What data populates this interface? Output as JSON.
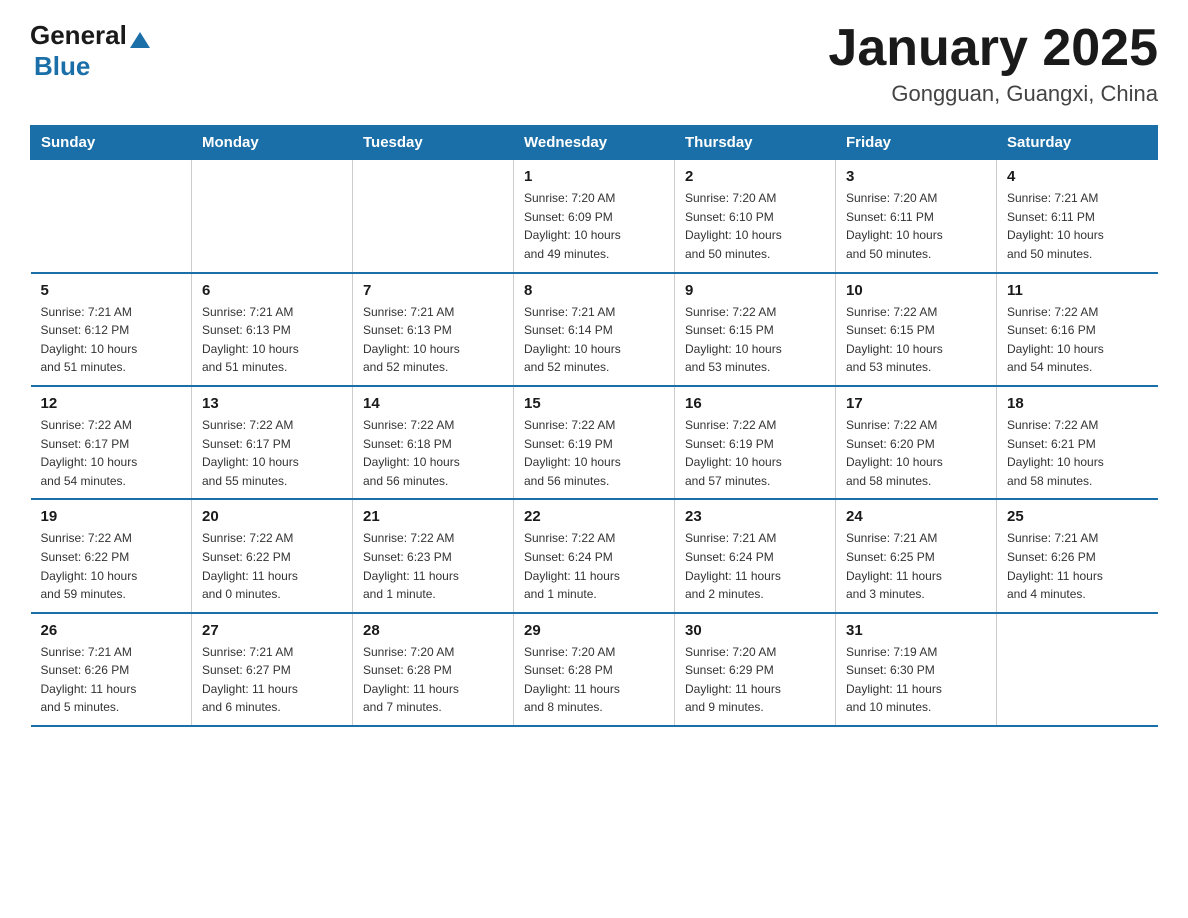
{
  "logo": {
    "general": "General",
    "triangle_color": "#1a6fa8",
    "blue": "Blue"
  },
  "title": "January 2025",
  "location": "Gongguan, Guangxi, China",
  "days_of_week": [
    "Sunday",
    "Monday",
    "Tuesday",
    "Wednesday",
    "Thursday",
    "Friday",
    "Saturday"
  ],
  "weeks": [
    [
      {
        "day": "",
        "info": ""
      },
      {
        "day": "",
        "info": ""
      },
      {
        "day": "",
        "info": ""
      },
      {
        "day": "1",
        "info": "Sunrise: 7:20 AM\nSunset: 6:09 PM\nDaylight: 10 hours\nand 49 minutes."
      },
      {
        "day": "2",
        "info": "Sunrise: 7:20 AM\nSunset: 6:10 PM\nDaylight: 10 hours\nand 50 minutes."
      },
      {
        "day": "3",
        "info": "Sunrise: 7:20 AM\nSunset: 6:11 PM\nDaylight: 10 hours\nand 50 minutes."
      },
      {
        "day": "4",
        "info": "Sunrise: 7:21 AM\nSunset: 6:11 PM\nDaylight: 10 hours\nand 50 minutes."
      }
    ],
    [
      {
        "day": "5",
        "info": "Sunrise: 7:21 AM\nSunset: 6:12 PM\nDaylight: 10 hours\nand 51 minutes."
      },
      {
        "day": "6",
        "info": "Sunrise: 7:21 AM\nSunset: 6:13 PM\nDaylight: 10 hours\nand 51 minutes."
      },
      {
        "day": "7",
        "info": "Sunrise: 7:21 AM\nSunset: 6:13 PM\nDaylight: 10 hours\nand 52 minutes."
      },
      {
        "day": "8",
        "info": "Sunrise: 7:21 AM\nSunset: 6:14 PM\nDaylight: 10 hours\nand 52 minutes."
      },
      {
        "day": "9",
        "info": "Sunrise: 7:22 AM\nSunset: 6:15 PM\nDaylight: 10 hours\nand 53 minutes."
      },
      {
        "day": "10",
        "info": "Sunrise: 7:22 AM\nSunset: 6:15 PM\nDaylight: 10 hours\nand 53 minutes."
      },
      {
        "day": "11",
        "info": "Sunrise: 7:22 AM\nSunset: 6:16 PM\nDaylight: 10 hours\nand 54 minutes."
      }
    ],
    [
      {
        "day": "12",
        "info": "Sunrise: 7:22 AM\nSunset: 6:17 PM\nDaylight: 10 hours\nand 54 minutes."
      },
      {
        "day": "13",
        "info": "Sunrise: 7:22 AM\nSunset: 6:17 PM\nDaylight: 10 hours\nand 55 minutes."
      },
      {
        "day": "14",
        "info": "Sunrise: 7:22 AM\nSunset: 6:18 PM\nDaylight: 10 hours\nand 56 minutes."
      },
      {
        "day": "15",
        "info": "Sunrise: 7:22 AM\nSunset: 6:19 PM\nDaylight: 10 hours\nand 56 minutes."
      },
      {
        "day": "16",
        "info": "Sunrise: 7:22 AM\nSunset: 6:19 PM\nDaylight: 10 hours\nand 57 minutes."
      },
      {
        "day": "17",
        "info": "Sunrise: 7:22 AM\nSunset: 6:20 PM\nDaylight: 10 hours\nand 58 minutes."
      },
      {
        "day": "18",
        "info": "Sunrise: 7:22 AM\nSunset: 6:21 PM\nDaylight: 10 hours\nand 58 minutes."
      }
    ],
    [
      {
        "day": "19",
        "info": "Sunrise: 7:22 AM\nSunset: 6:22 PM\nDaylight: 10 hours\nand 59 minutes."
      },
      {
        "day": "20",
        "info": "Sunrise: 7:22 AM\nSunset: 6:22 PM\nDaylight: 11 hours\nand 0 minutes."
      },
      {
        "day": "21",
        "info": "Sunrise: 7:22 AM\nSunset: 6:23 PM\nDaylight: 11 hours\nand 1 minute."
      },
      {
        "day": "22",
        "info": "Sunrise: 7:22 AM\nSunset: 6:24 PM\nDaylight: 11 hours\nand 1 minute."
      },
      {
        "day": "23",
        "info": "Sunrise: 7:21 AM\nSunset: 6:24 PM\nDaylight: 11 hours\nand 2 minutes."
      },
      {
        "day": "24",
        "info": "Sunrise: 7:21 AM\nSunset: 6:25 PM\nDaylight: 11 hours\nand 3 minutes."
      },
      {
        "day": "25",
        "info": "Sunrise: 7:21 AM\nSunset: 6:26 PM\nDaylight: 11 hours\nand 4 minutes."
      }
    ],
    [
      {
        "day": "26",
        "info": "Sunrise: 7:21 AM\nSunset: 6:26 PM\nDaylight: 11 hours\nand 5 minutes."
      },
      {
        "day": "27",
        "info": "Sunrise: 7:21 AM\nSunset: 6:27 PM\nDaylight: 11 hours\nand 6 minutes."
      },
      {
        "day": "28",
        "info": "Sunrise: 7:20 AM\nSunset: 6:28 PM\nDaylight: 11 hours\nand 7 minutes."
      },
      {
        "day": "29",
        "info": "Sunrise: 7:20 AM\nSunset: 6:28 PM\nDaylight: 11 hours\nand 8 minutes."
      },
      {
        "day": "30",
        "info": "Sunrise: 7:20 AM\nSunset: 6:29 PM\nDaylight: 11 hours\nand 9 minutes."
      },
      {
        "day": "31",
        "info": "Sunrise: 7:19 AM\nSunset: 6:30 PM\nDaylight: 11 hours\nand 10 minutes."
      },
      {
        "day": "",
        "info": ""
      }
    ]
  ]
}
